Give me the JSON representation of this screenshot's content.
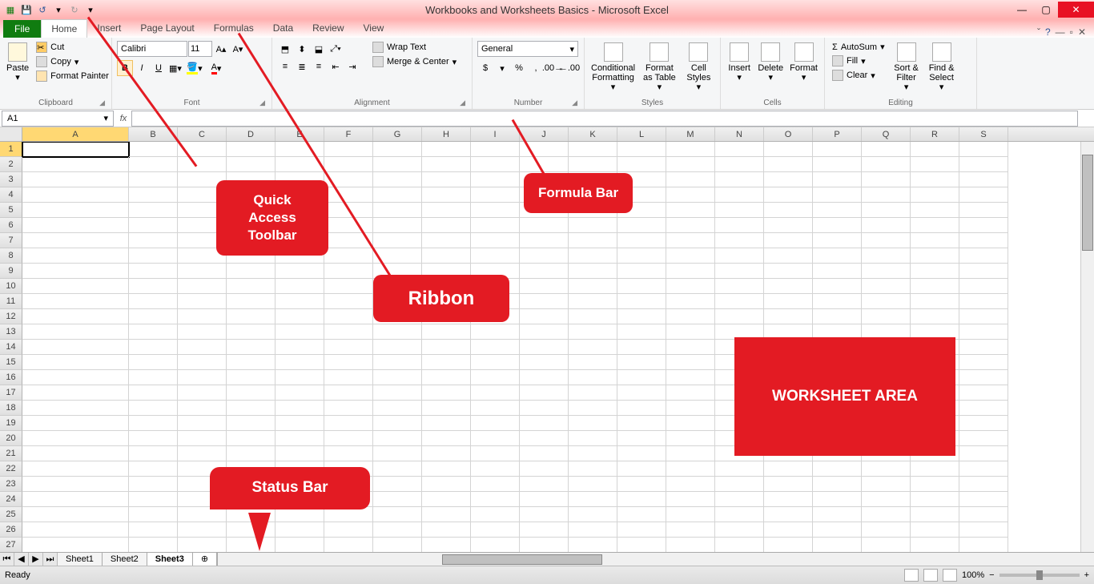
{
  "title": "Workbooks and Worksheets Basics - Microsoft Excel",
  "qat": {
    "customize_tip": "▾"
  },
  "tabs": {
    "file": "File",
    "items": [
      "Home",
      "Insert",
      "Page Layout",
      "Formulas",
      "Data",
      "Review",
      "View"
    ],
    "active": "Home"
  },
  "ribbon": {
    "clipboard": {
      "label": "Clipboard",
      "paste": "Paste",
      "cut": "Cut",
      "copy": "Copy",
      "painter": "Format Painter"
    },
    "font": {
      "label": "Font",
      "name": "Calibri",
      "size": "11",
      "bold": "B",
      "italic": "I",
      "underline": "U"
    },
    "alignment": {
      "label": "Alignment",
      "wrap": "Wrap Text",
      "merge": "Merge & Center"
    },
    "number": {
      "label": "Number",
      "format": "General",
      "currency": "$",
      "percent": "%",
      "comma": ","
    },
    "styles": {
      "label": "Styles",
      "cond": "Conditional Formatting",
      "table": "Format as Table",
      "cell": "Cell Styles"
    },
    "cells": {
      "label": "Cells",
      "insert": "Insert",
      "delete": "Delete",
      "format": "Format"
    },
    "editing": {
      "label": "Editing",
      "autosum": "AutoSum",
      "fill": "Fill",
      "clear": "Clear",
      "sort": "Sort & Filter",
      "find": "Find & Select"
    }
  },
  "nameBox": "A1",
  "columns": [
    "A",
    "B",
    "C",
    "D",
    "E",
    "F",
    "G",
    "H",
    "I",
    "J",
    "K",
    "L",
    "M",
    "N",
    "O",
    "P",
    "Q",
    "R",
    "S"
  ],
  "rowCount": 27,
  "activeCell": {
    "row": 1,
    "col": "A"
  },
  "sheets": {
    "nav": [
      "⏮",
      "◀",
      "▶",
      "⏭"
    ],
    "tabs": [
      "Sheet1",
      "Sheet2",
      "Sheet3"
    ],
    "active": "Sheet3"
  },
  "status": {
    "ready": "Ready",
    "zoom": "100%"
  },
  "callouts": {
    "qat": "Quick Access Toolbar",
    "ribbon": "Ribbon",
    "formula": "Formula Bar",
    "status": "Status Bar",
    "worksheet": "WORKSHEET AREA"
  }
}
